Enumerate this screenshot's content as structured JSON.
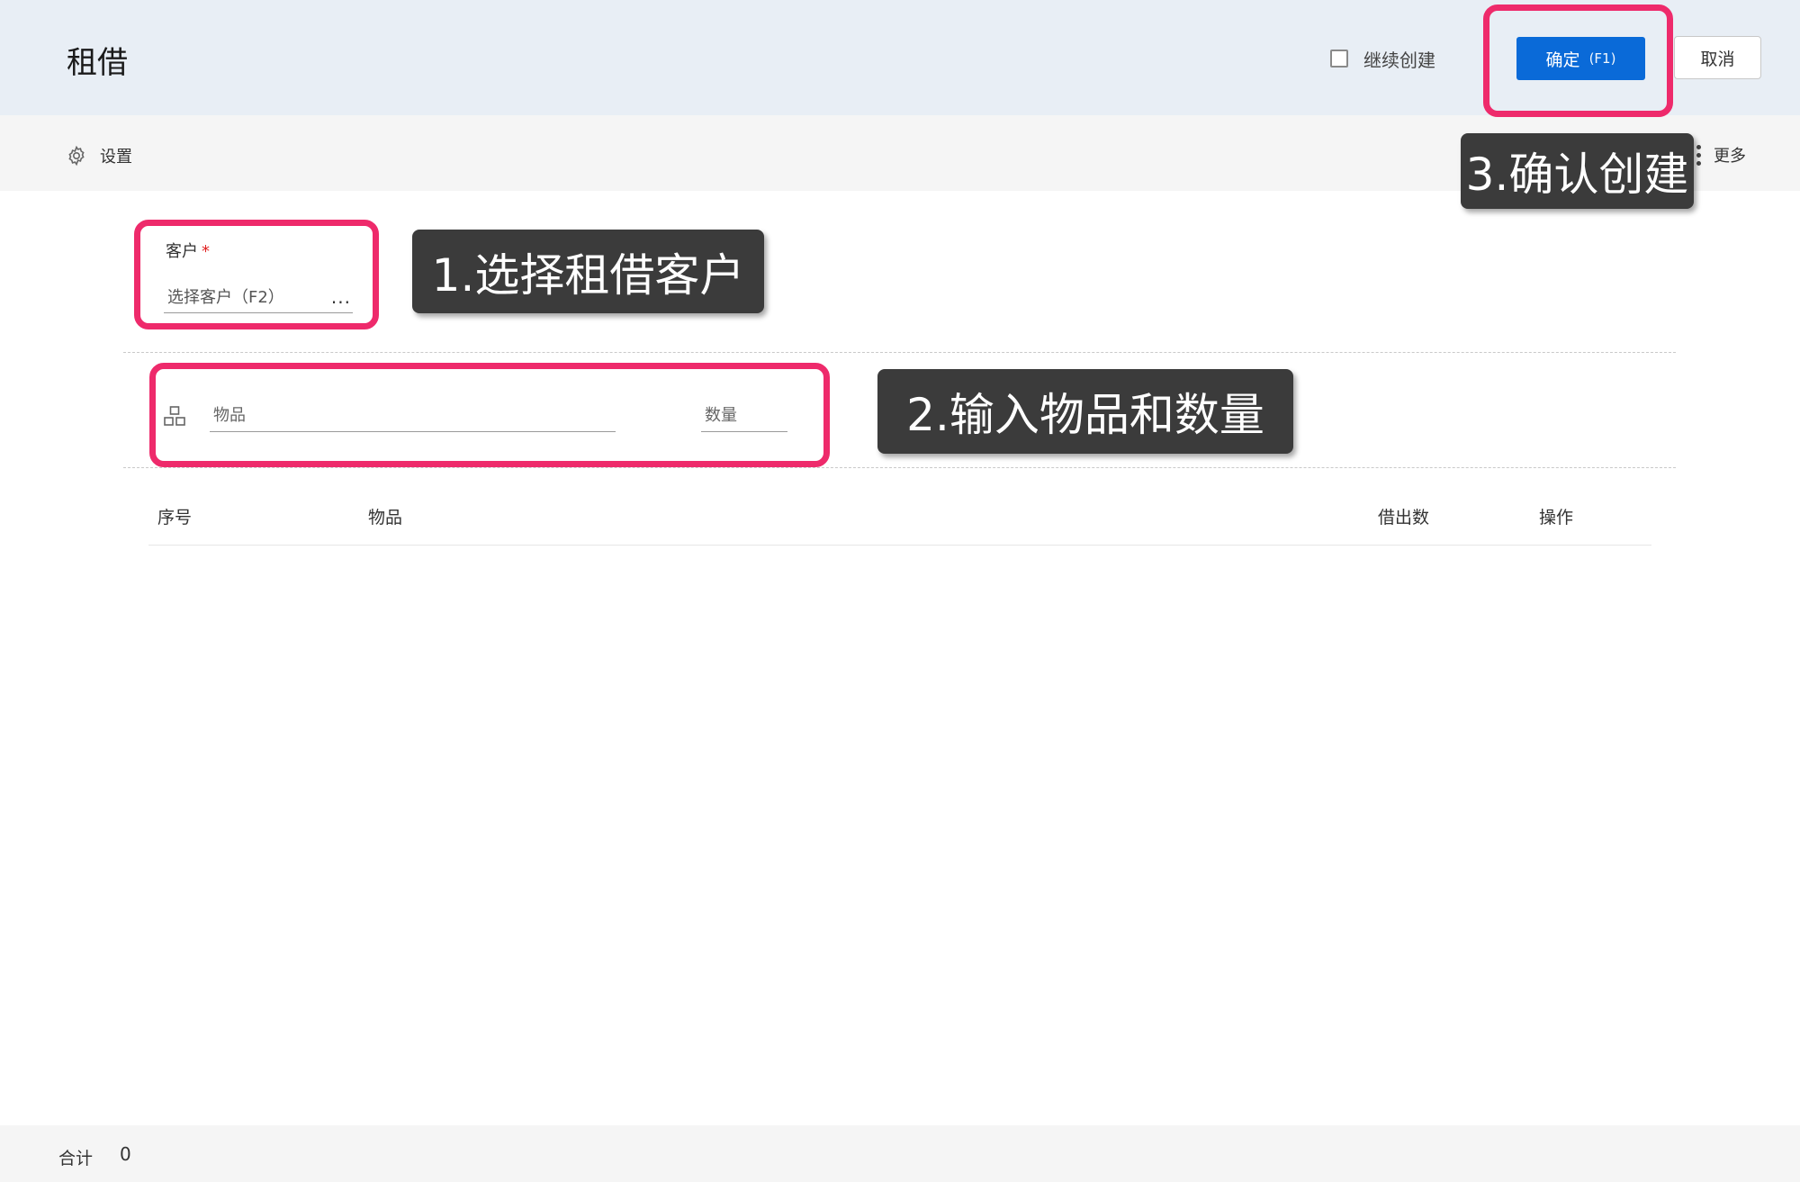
{
  "header": {
    "title": "租借",
    "continue_create_label": "继续创建",
    "confirm_label": "确定",
    "confirm_hint": "(F1)",
    "cancel_label": "取消"
  },
  "toolbar": {
    "settings_label": "设置",
    "more_label": "更多"
  },
  "form": {
    "customer_label": "客户",
    "customer_required_mark": "*",
    "customer_placeholder": "选择客户（F2）",
    "customer_more": "...",
    "item_placeholder": "物品",
    "quantity_placeholder": "数量"
  },
  "table": {
    "columns": [
      "序号",
      "物品",
      "借出数",
      "操作"
    ]
  },
  "footer": {
    "total_label": "合计",
    "total_value": "0"
  },
  "annotations": {
    "step1": "1.选择租借客户",
    "step2": "2.输入物品和数量",
    "step3": "3.确认创建"
  },
  "colors": {
    "header_bg": "#e8eef5",
    "primary": "#0a6ad8",
    "highlight": "#ee2a6b",
    "callout_bg": "#3b3b3b"
  }
}
